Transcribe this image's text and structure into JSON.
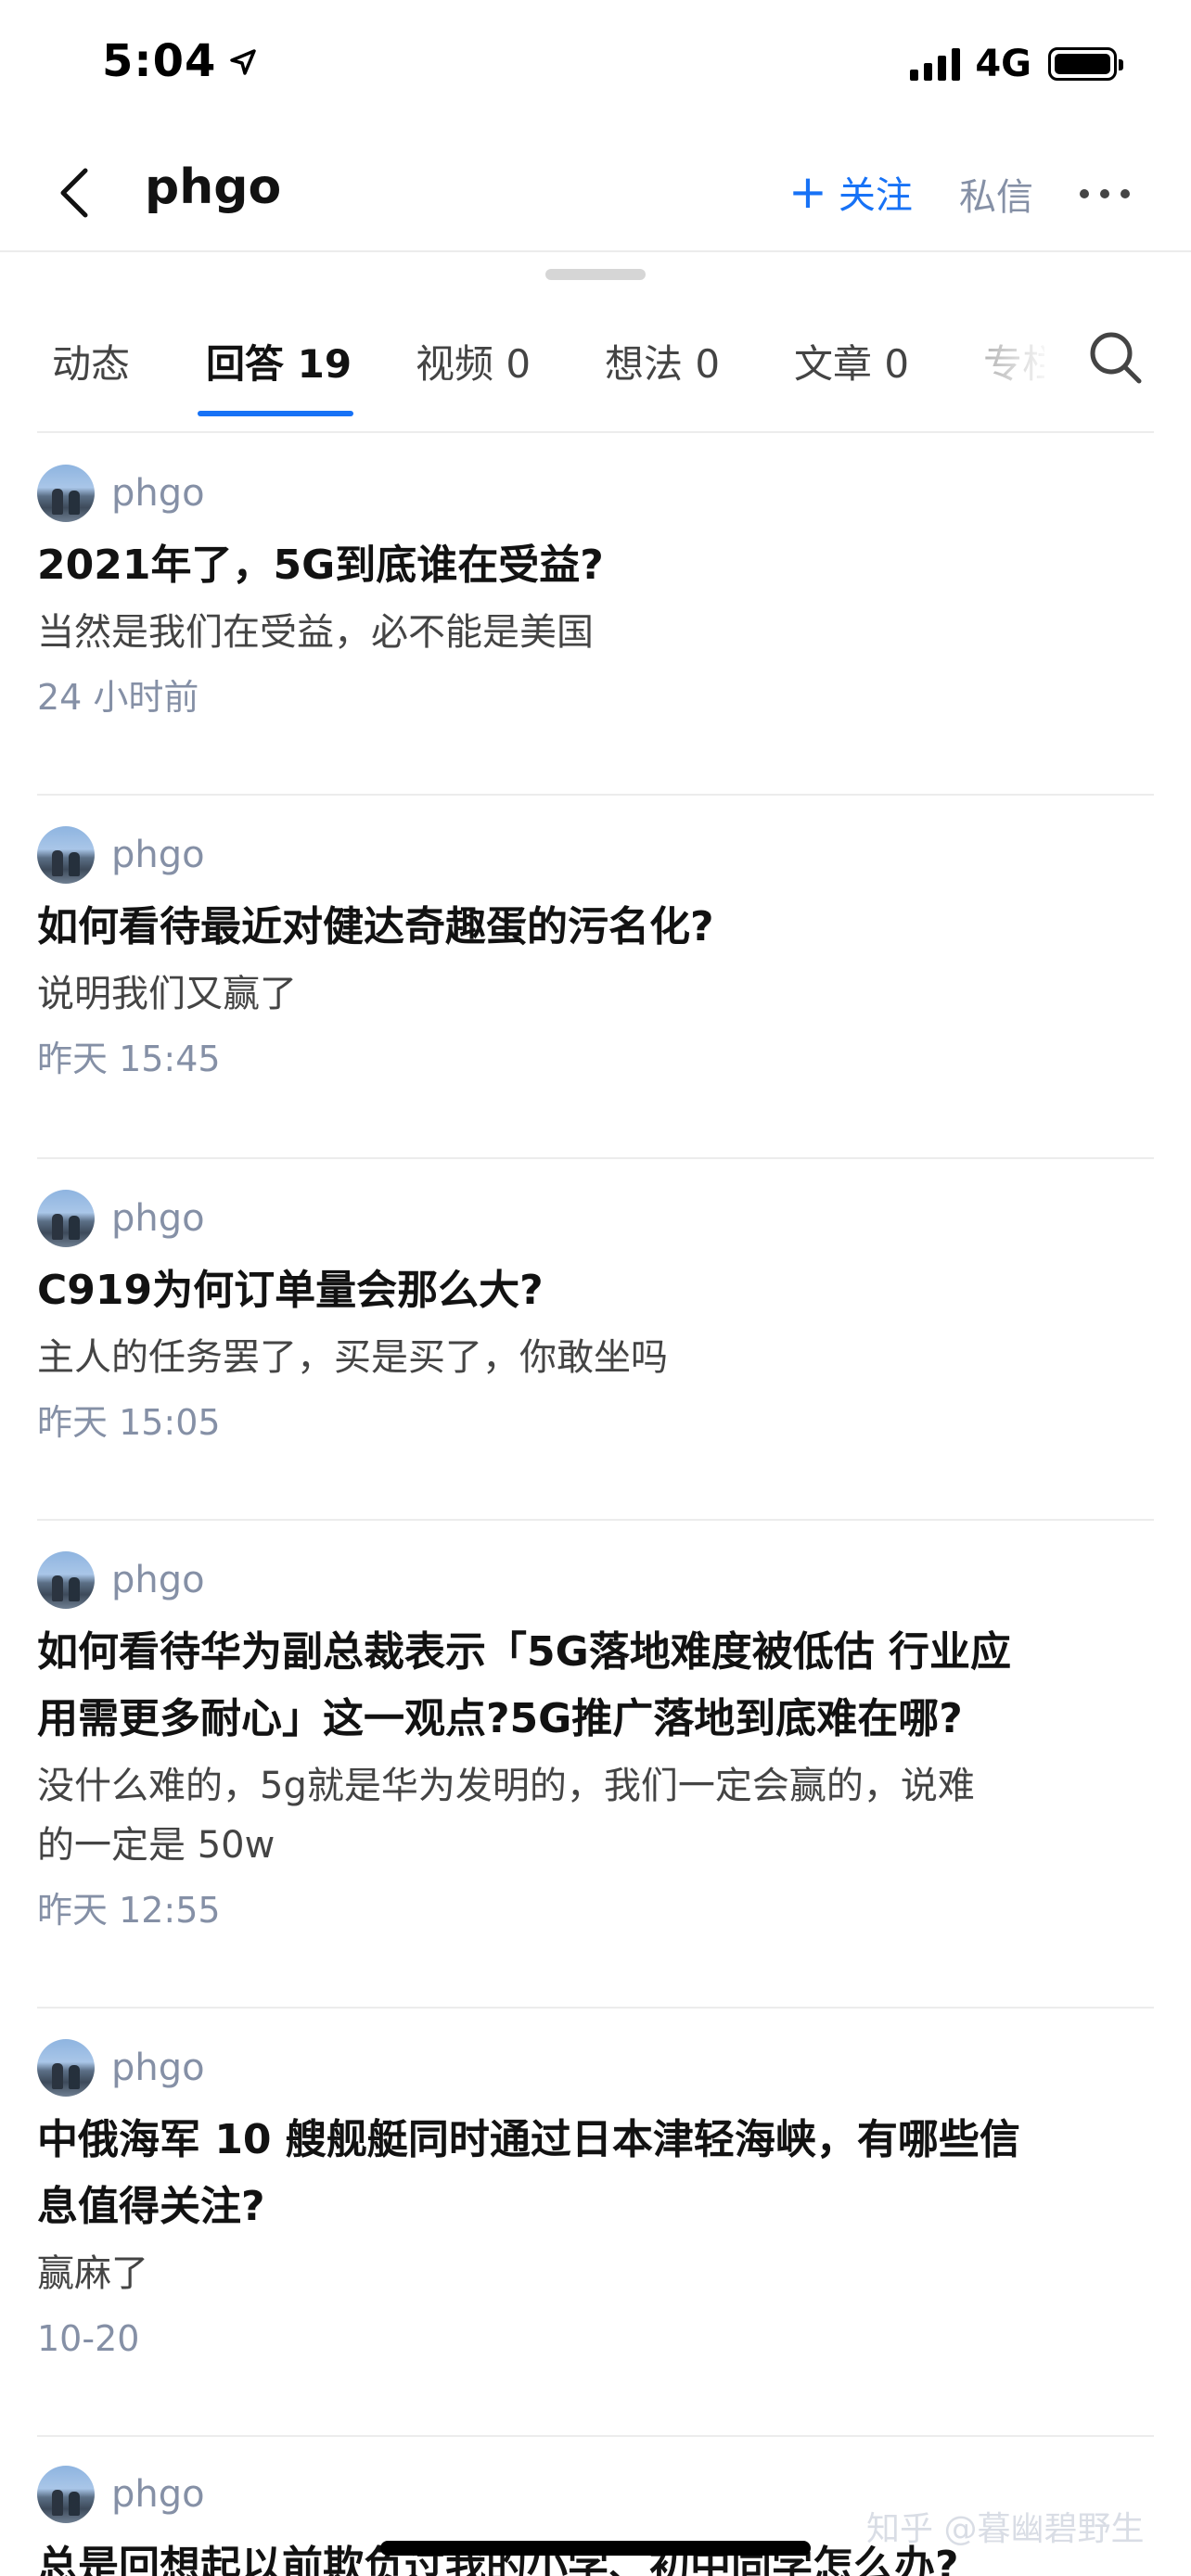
{
  "status_bar": {
    "time": "5:04",
    "network": "4G"
  },
  "nav": {
    "title": "phgo",
    "follow_label": "关注",
    "follow_plus": "+",
    "message_label": "私信"
  },
  "tabs": [
    {
      "label": "动态"
    },
    {
      "label": "回答 19"
    },
    {
      "label": "视频 0"
    },
    {
      "label": "想法 0"
    },
    {
      "label": "文章 0"
    },
    {
      "label": "专栏"
    }
  ],
  "answers": [
    {
      "author": "phgo",
      "title": "2021年了，5G到底谁在受益?",
      "excerpt": "当然是我们在受益，必不能是美国",
      "time": "24 小时前"
    },
    {
      "author": "phgo",
      "title": "如何看待最近对健达奇趣蛋的污名化?",
      "excerpt": "说明我们又赢了",
      "time": "昨天 15:45"
    },
    {
      "author": "phgo",
      "title": "C919为何订单量会那么大?",
      "excerpt": "主人的任务罢了，买是买了，你敢坐吗",
      "time": "昨天 15:05"
    },
    {
      "author": "phgo",
      "title_line1": "如何看待华为副总裁表示「5G落地难度被低估 行业应",
      "title_line2": "用需更多耐心」这一观点?5G推广落地到底难在哪?",
      "excerpt_line1": "没什么难的，5g就是华为发明的，我们一定会赢的，说难",
      "excerpt_line2": "的一定是 50w",
      "time": "昨天 12:55"
    },
    {
      "author": "phgo",
      "title_line1": "中俄海军 10 艘舰艇同时通过日本津轻海峡，有哪些信",
      "title_line2": "息值得关注?",
      "excerpt": "赢麻了",
      "time": "10-20"
    },
    {
      "author": "phgo",
      "title": "总是回想起以前欺负过我的小学、初中同学怎么办?"
    }
  ],
  "watermark": "知乎 @暮幽碧野生"
}
